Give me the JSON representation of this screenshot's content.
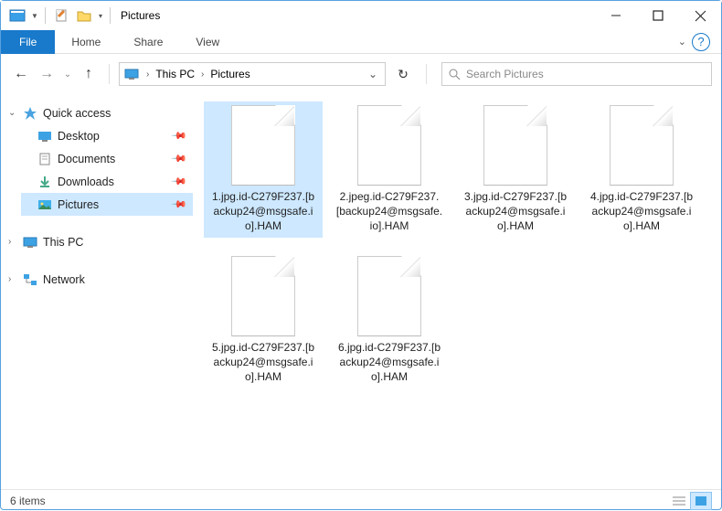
{
  "title_bar": {
    "title": "Pictures"
  },
  "ribbon": {
    "tabs": [
      "Home",
      "Share",
      "View"
    ],
    "file": "File"
  },
  "breadcrumb": {
    "segments": [
      "This PC",
      "Pictures"
    ]
  },
  "search": {
    "placeholder": "Search Pictures"
  },
  "sidebar": {
    "quick_access": "Quick access",
    "items": [
      {
        "label": "Desktop",
        "pinned": true
      },
      {
        "label": "Documents",
        "pinned": true
      },
      {
        "label": "Downloads",
        "pinned": true
      },
      {
        "label": "Pictures",
        "pinned": true,
        "selected": true
      }
    ],
    "this_pc": "This PC",
    "network": "Network"
  },
  "files": [
    {
      "label": "1.jpg.id-C279F237.[backup24@msgsafe.io].HAM",
      "selected": true
    },
    {
      "label": "2.jpeg.id-C279F237.[backup24@msgsafe.io].HAM"
    },
    {
      "label": "3.jpg.id-C279F237.[backup24@msgsafe.io].HAM"
    },
    {
      "label": "4.jpg.id-C279F237.[backup24@msgsafe.io].HAM"
    },
    {
      "label": "5.jpg.id-C279F237.[backup24@msgsafe.io].HAM"
    },
    {
      "label": "6.jpg.id-C279F237.[backup24@msgsafe.io].HAM"
    }
  ],
  "status": {
    "count_label": "6 items"
  }
}
